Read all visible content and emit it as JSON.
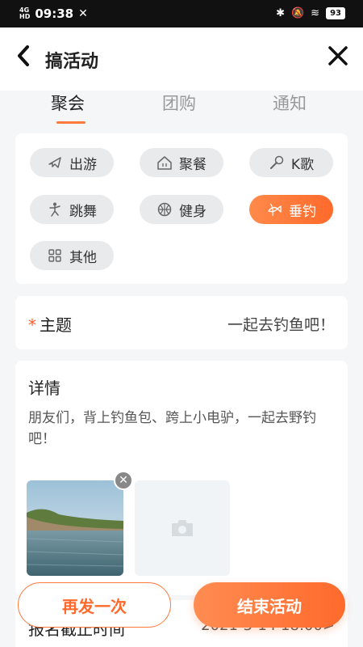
{
  "status_bar": {
    "network": "4G",
    "network_sub": "HD",
    "time": "09:38",
    "battery": "93"
  },
  "header": {
    "title": "搞活动"
  },
  "tabs": [
    {
      "label": "聚会",
      "active": true
    },
    {
      "label": "团购",
      "active": false
    },
    {
      "label": "通知",
      "active": false
    }
  ],
  "categories": [
    {
      "label": "出游",
      "icon": "plane-icon",
      "active": false
    },
    {
      "label": "聚餐",
      "icon": "restaurant-icon",
      "active": false
    },
    {
      "label": "K歌",
      "icon": "microphone-icon",
      "active": false
    },
    {
      "label": "跳舞",
      "icon": "dance-icon",
      "active": false
    },
    {
      "label": "健身",
      "icon": "ball-icon",
      "active": false
    },
    {
      "label": "垂钓",
      "icon": "fishing-icon",
      "active": true
    },
    {
      "label": "其他",
      "icon": "grid-icon",
      "active": false
    }
  ],
  "topic": {
    "label": "主题",
    "required_mark": "*",
    "value": "一起去钓鱼吧！"
  },
  "detail": {
    "label": "详情",
    "text": "朋友们，背上钓鱼包、跨上小电驴，一起去野钓吧！"
  },
  "deadline": {
    "label": "报名截止时间",
    "value": "2021-3-14 18:00>"
  },
  "buttons": {
    "repeat": "再发一次",
    "end": "结束活动"
  },
  "colors": {
    "accent": "#ff6a2b",
    "chip_bg": "#e9eaec"
  }
}
